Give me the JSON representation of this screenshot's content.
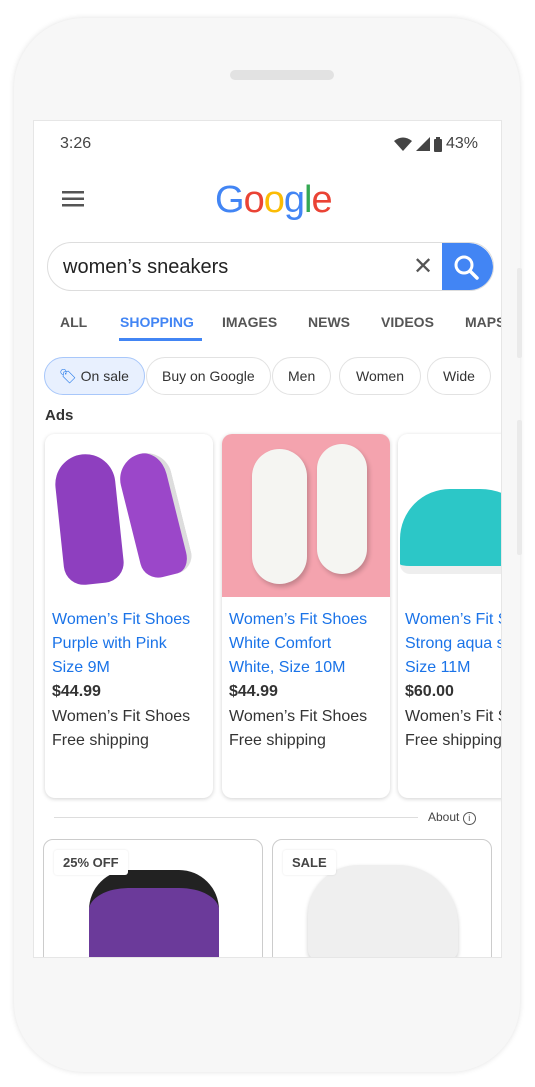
{
  "status": {
    "time": "3:26",
    "battery": "43%"
  },
  "logo": "Google",
  "search": {
    "query": "women’s sneakers"
  },
  "tabs": [
    {
      "label": "ALL"
    },
    {
      "label": "SHOPPING",
      "active": true
    },
    {
      "label": "IMAGES"
    },
    {
      "label": "NEWS"
    },
    {
      "label": "VIDEOS"
    },
    {
      "label": "MAPS"
    }
  ],
  "chips": [
    {
      "label": "On sale",
      "selected": true
    },
    {
      "label": "Buy on Google"
    },
    {
      "label": "Men"
    },
    {
      "label": "Women"
    },
    {
      "label": "Wide"
    }
  ],
  "ads_label": "Ads",
  "ads": [
    {
      "title": [
        "Women’s Fit Shoes",
        "Purple with Pink",
        "Size 9M"
      ],
      "price": "$44.99",
      "store": "Women’s Fit Shoes",
      "shipping": "Free shipping"
    },
    {
      "title": [
        "Women’s Fit Shoes",
        "White Comfort",
        "White, Size 10M"
      ],
      "price": "$44.99",
      "store": "Women’s Fit Shoes",
      "shipping": "Free shipping"
    },
    {
      "title": [
        "Women’s Fit Shoes",
        "Strong aqua shoes",
        "Size 11M"
      ],
      "price": "$60.00",
      "store": "Women’s Fit Shoes",
      "shipping": "Free shipping"
    }
  ],
  "about": "About",
  "products": [
    {
      "badge": "25% OFF"
    },
    {
      "badge": "SALE"
    }
  ],
  "colors": {
    "accent": "#4285f4",
    "link": "#1a73e8"
  }
}
